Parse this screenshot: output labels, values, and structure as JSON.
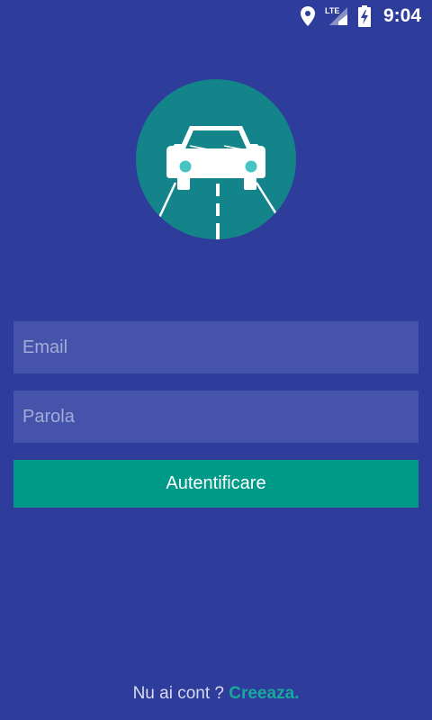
{
  "status_bar": {
    "icons": [
      "location-icon",
      "lte-signal-icon",
      "battery-charging-icon"
    ],
    "network_label": "LTE",
    "time": "9:04"
  },
  "logo": {
    "icon": "car-road-icon"
  },
  "form": {
    "email_placeholder": "Email",
    "password_placeholder": "Parola",
    "login_label": "Autentificare"
  },
  "footer": {
    "prompt": "Nu ai cont ? ",
    "link": "Creeaza."
  },
  "colors": {
    "background": "#2e3c9b",
    "input_background": "#4553aa",
    "accent": "#009a88",
    "logo_circle": "#13858a",
    "link": "#19a99a"
  }
}
